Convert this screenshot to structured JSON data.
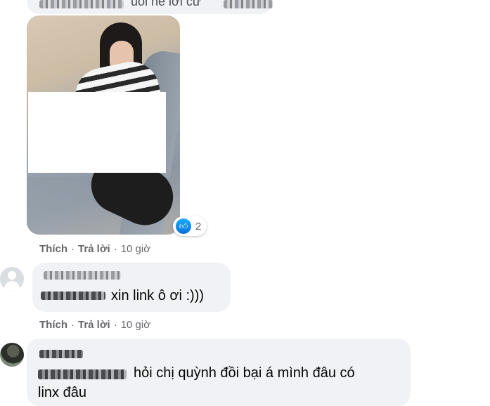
{
  "top_comment": {
    "text_partial": "uổi nè lơi cư"
  },
  "reaction": {
    "icon": "like-icon",
    "count": "2"
  },
  "first_actions": {
    "like": "Thích",
    "reply": "Trả lời",
    "time": "10 giờ",
    "separator": "·"
  },
  "second_comment": {
    "text": "xin link ô ơi :)))"
  },
  "second_actions": {
    "like": "Thích",
    "reply": "Trả lời",
    "time": "10 giờ",
    "separator": "·"
  },
  "third_comment": {
    "line1": "hỏi chị quỳnh đồi bại á mình đâu có",
    "line2": "linx đâu"
  },
  "colors": {
    "bubble": "#f0f2f5",
    "meta_text": "#65676b",
    "like_blue": "#0a6fd8"
  }
}
